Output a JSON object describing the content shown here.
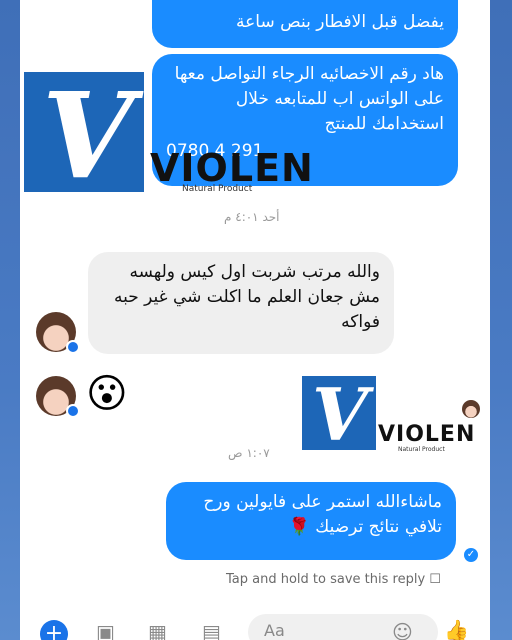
{
  "messages": {
    "top_partial": "يفضل قبل الافطار بنص ساعة",
    "number_info": "هاد رقم الاخصائيه الرجاء التواصل معها على الواتس اب للمتابعه خلال استخدامك للمنتج",
    "number_partial": "0780 4 291",
    "time1": "أحد ٤:٠١ م",
    "incoming_text": "والله مرتب شربت اول كيس ولهسه مش جعان العلم ما اكلت شي غير حبه فواكه",
    "time2": "١:٠٧ ص",
    "reply_text": "ماشاءالله استمر على فايولين ورح تلافي نتائج ترضيك 🌹"
  },
  "logo": {
    "letter": "V",
    "word": "VIOLEN",
    "tagline": "Natural Product"
  },
  "reactions": {
    "emoji": "😮"
  },
  "footer": {
    "hint": "Tap and hold to save this reply ☐"
  },
  "composer": {
    "placeholder": "Aa"
  },
  "colors": {
    "outgoing": "#1a8cff",
    "incoming": "#efefef",
    "brand": "#1d66b7"
  },
  "icons": [
    "plus-icon",
    "camera-icon",
    "gallery-icon",
    "sticker-icon",
    "emoji-icon",
    "like-icon"
  ]
}
